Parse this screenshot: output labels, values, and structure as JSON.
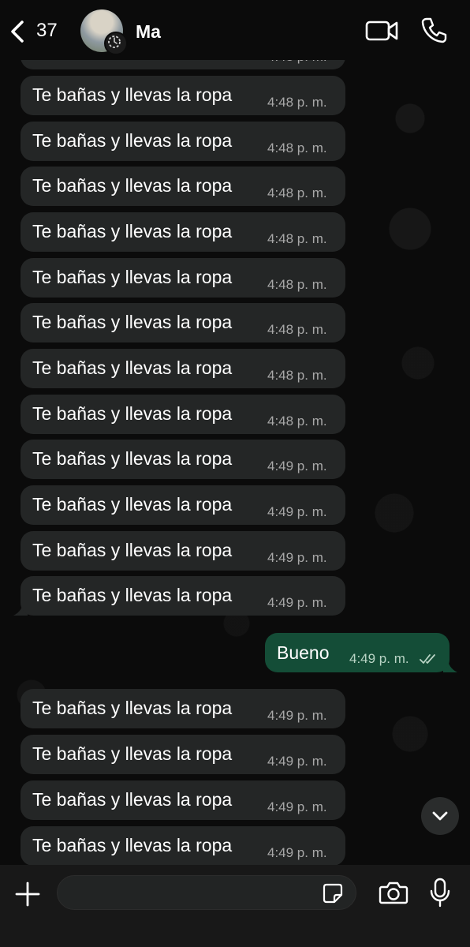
{
  "header": {
    "back_count": "37",
    "contact_name": "Ma"
  },
  "messages_incoming_top": [
    {
      "text": "Te bañas y llevas la ropa",
      "time": "4:48 p. m."
    },
    {
      "text": "Te bañas y llevas la ropa",
      "time": "4:48 p. m."
    },
    {
      "text": "Te bañas y llevas la ropa",
      "time": "4:48 p. m."
    },
    {
      "text": "Te bañas y llevas la ropa",
      "time": "4:48 p. m."
    },
    {
      "text": "Te bañas y llevas la ropa",
      "time": "4:48 p. m."
    },
    {
      "text": "Te bañas y llevas la ropa",
      "time": "4:48 p. m."
    },
    {
      "text": "Te bañas y llevas la ropa",
      "time": "4:48 p. m."
    },
    {
      "text": "Te bañas y llevas la ropa",
      "time": "4:48 p. m."
    },
    {
      "text": "Te bañas y llevas la ropa",
      "time": "4:49 p. m."
    },
    {
      "text": "Te bañas y llevas la ropa",
      "time": "4:49 p. m."
    },
    {
      "text": "Te bañas y llevas la ropa",
      "time": "4:49 p. m."
    },
    {
      "text": "Te bañas y llevas la ropa",
      "time": "4:49 p. m."
    }
  ],
  "message_outgoing": {
    "text": "Bueno",
    "time": "4:49 p. m."
  },
  "messages_incoming_bottom": [
    {
      "text": "Te bañas y llevas la ropa",
      "time": "4:49 p. m."
    },
    {
      "text": "Te bañas y llevas la ropa",
      "time": "4:49 p. m."
    },
    {
      "text": "Te bañas y llevas la ropa",
      "time": "4:49 p. m."
    },
    {
      "text": "Te bañas y llevas la ropa",
      "time": "4:49 p. m."
    }
  ],
  "composer": {
    "placeholder": ""
  },
  "colors": {
    "background": "#0b0b0b",
    "incoming_bubble": "#242626",
    "outgoing_bubble": "#144d37",
    "read_ticks": "#b9d4c5"
  },
  "icons": [
    "back-chevron-icon",
    "video-call-icon",
    "phone-icon",
    "chevron-down-icon",
    "plus-icon",
    "sticker-icon",
    "camera-icon",
    "microphone-icon"
  ]
}
